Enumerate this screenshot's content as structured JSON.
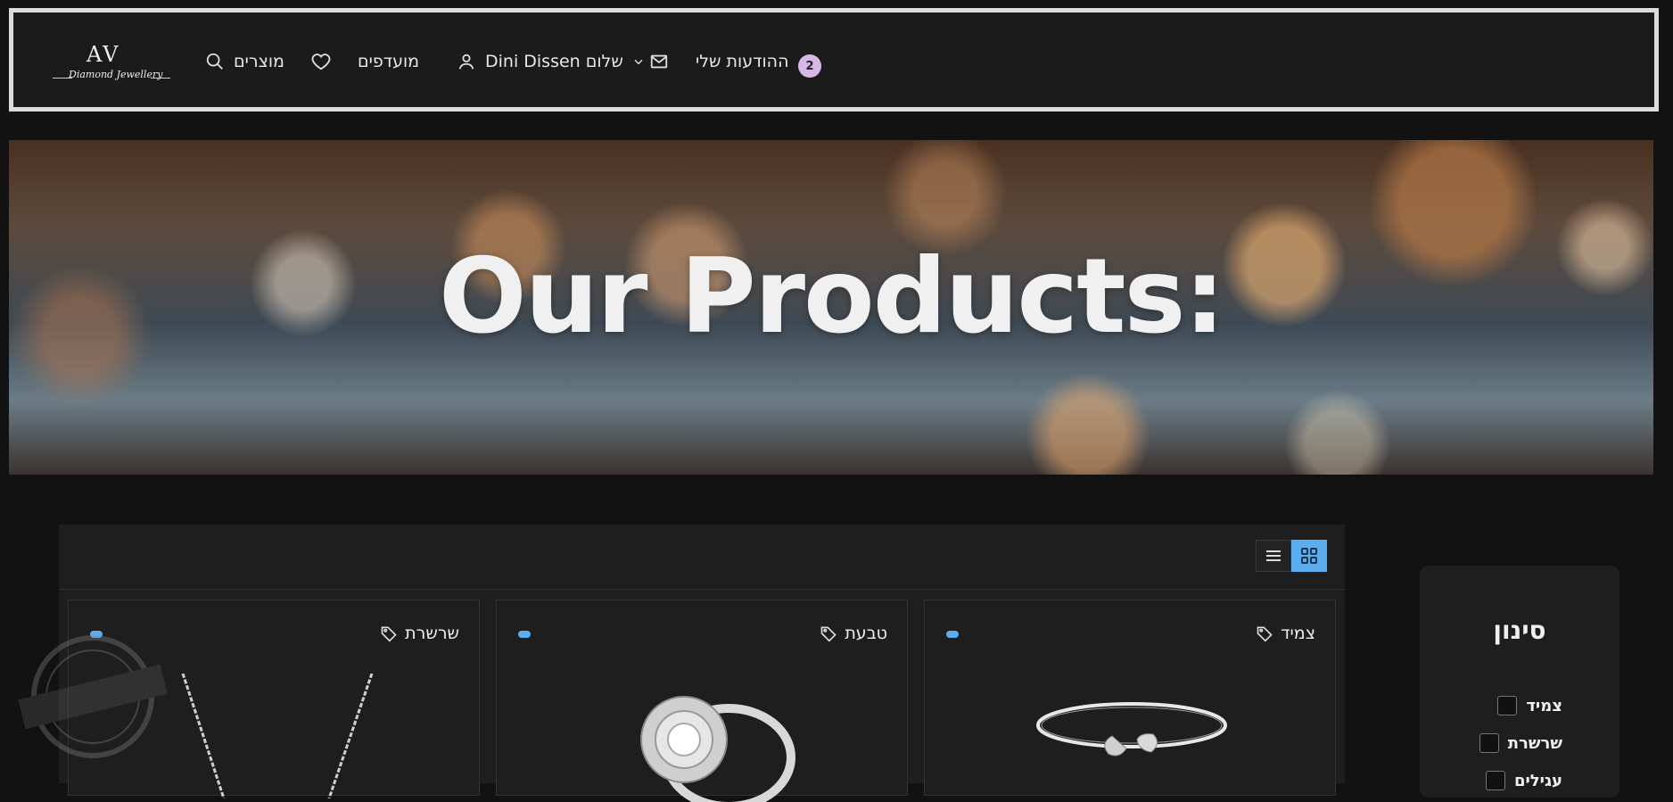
{
  "header": {
    "logo": {
      "monogram": "AV",
      "script": "Diamond Jewellery"
    },
    "nav": {
      "products": "מוצרים",
      "favorites": "מועדפים",
      "user": "Dini Dissen שלום",
      "messages": "ההודעות שלי",
      "message_count": "2"
    }
  },
  "hero": {
    "title": "Our Products:"
  },
  "catalog": {
    "cards": [
      {
        "category": "צמיד"
      },
      {
        "category": "טבעת"
      },
      {
        "category": "שרשרת"
      }
    ]
  },
  "filter": {
    "title": "סינון",
    "options": [
      "צמיד",
      "שרשרת",
      "עגילים"
    ]
  },
  "colors": {
    "accent": "#5aaef0",
    "badge": "#d6b7e6",
    "background": "#121212",
    "panel": "#1e1e1e"
  },
  "icons": [
    "search-icon",
    "heart-icon",
    "user-icon",
    "chevron-down-icon",
    "mail-icon",
    "list-view-icon",
    "grid-view-icon",
    "tag-icon"
  ]
}
